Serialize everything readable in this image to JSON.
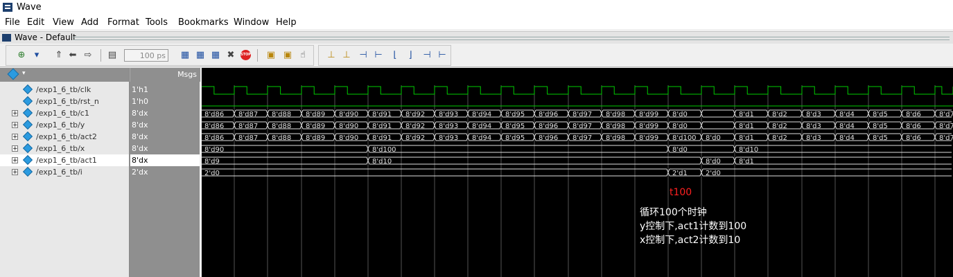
{
  "window": {
    "title": "Wave"
  },
  "menubar": [
    "File",
    "Edit",
    "View",
    "Add",
    "Format",
    "Tools",
    "Bookmarks",
    "Window",
    "Help"
  ],
  "subwindow": {
    "title": "Wave - Default"
  },
  "toolbar": {
    "time_value": "100 ps",
    "stop_label": "STOP"
  },
  "signal_panel": {
    "header": "Msgs"
  },
  "signals": [
    {
      "name": "/exp1_6_tb/clk",
      "value": "1'h1",
      "expandable": false
    },
    {
      "name": "/exp1_6_tb/rst_n",
      "value": "1'h0",
      "expandable": false
    },
    {
      "name": "/exp1_6_tb/c1",
      "value": "8'dx",
      "expandable": true
    },
    {
      "name": "/exp1_6_tb/y",
      "value": "8'dx",
      "expandable": true
    },
    {
      "name": "/exp1_6_tb/act2",
      "value": "8'dx",
      "expandable": true
    },
    {
      "name": "/exp1_6_tb/x",
      "value": "8'dx",
      "expandable": true
    },
    {
      "name": "/exp1_6_tb/act1",
      "value": "8'dx",
      "expandable": true,
      "selected": true
    },
    {
      "name": "/exp1_6_tb/i",
      "value": "2'dx",
      "expandable": true
    }
  ],
  "bus_waves": {
    "c1": [
      "8'd86",
      "8'd87",
      "8'd88",
      "8'd89",
      "8'd90",
      "8'd91",
      "8'd92",
      "8'd93",
      "8'd94",
      "8'd95",
      "8'd96",
      "8'd97",
      "8'd98",
      "8'd99",
      "8'd0",
      "",
      "8'd1",
      "8'd2",
      "8'd3",
      "8'd4",
      "8'd5",
      "8'd6",
      "8'd7"
    ],
    "y": [
      "8'd86",
      "8'd87",
      "8'd88",
      "8'd89",
      "8'd90",
      "8'd91",
      "8'd92",
      "8'd93",
      "8'd94",
      "8'd95",
      "8'd96",
      "8'd97",
      "8'd98",
      "8'd99",
      "8'd0",
      "",
      "8'd1",
      "8'd2",
      "8'd3",
      "8'd4",
      "8'd5",
      "8'd6",
      "8'd7"
    ],
    "act2": [
      "8'd86",
      "8'd87",
      "8'd88",
      "8'd89",
      "8'd90",
      "8'd91",
      "8'd92",
      "8'd93",
      "8'd94",
      "8'd95",
      "8'd96",
      "8'd97",
      "8'd98",
      "8'd99",
      "8'd100",
      "8'd0",
      "8'd1",
      "8'd2",
      "8'd3",
      "8'd4",
      "8'd5",
      "8'd6",
      "8'd7"
    ],
    "x": [
      "8'd90",
      "8'd100",
      "8'd0",
      "8'd10"
    ],
    "act1": [
      "8'd9",
      "8'd10",
      "8'd0",
      "8'd1"
    ],
    "i": [
      "2'd0",
      "2'd1",
      "2'd0"
    ]
  },
  "annotations": {
    "marker": "t100",
    "line1": "循环100个时钟",
    "line2": "y控制下,act1计数到100",
    "line3": "x控制下,act2计数到10"
  },
  "colors": {
    "clock": "#00cc00",
    "bus": "#e0e0e0",
    "marker_text": "#ff2020",
    "background": "#000000"
  }
}
